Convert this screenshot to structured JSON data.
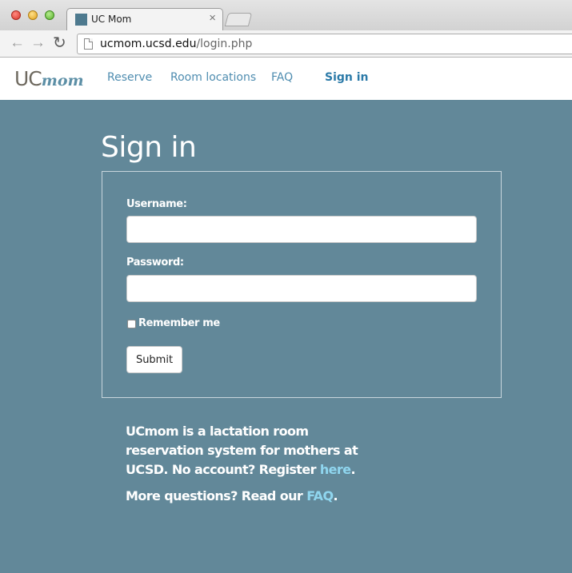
{
  "browser": {
    "tab_title": "UC Mom",
    "tab_close": "×",
    "url_host": "ucmom.ucsd.edu",
    "url_path": "/login.php",
    "back_glyph": "←",
    "forward_glyph": "→",
    "reload_glyph": "↻"
  },
  "site_nav": {
    "logo_uc": "UC",
    "logo_mom": "mom",
    "links": [
      {
        "label": "Reserve"
      },
      {
        "label": "Room locations"
      },
      {
        "label": "FAQ"
      },
      {
        "label": "Sign in",
        "active": true
      }
    ]
  },
  "login": {
    "title": "Sign in",
    "username_label": "Username:",
    "username_value": "",
    "password_label": "Password:",
    "password_value": "",
    "remember_label": "Remember me",
    "remember_checked": false,
    "submit_label": "Submit"
  },
  "info": {
    "line1_text": "UCmom is a lactation room reservation system for mothers at UCSD. No account? Register ",
    "line1_link": "here",
    "line1_end": ".",
    "line2_text": "More questions? Read our ",
    "line2_link": "FAQ",
    "line2_end": "."
  },
  "colors": {
    "page_background": "#628899",
    "link_accent": "#8fd6ef",
    "nav_link": "#4f8db0"
  }
}
